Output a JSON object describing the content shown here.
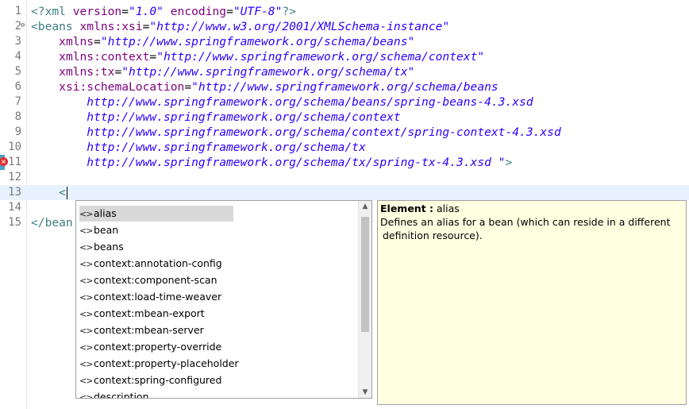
{
  "editor": {
    "lines": [
      {
        "n": "1",
        "parts": [
          {
            "c": "pi",
            "t": "<?xml "
          },
          {
            "c": "attr",
            "t": "version"
          },
          {
            "c": "",
            "t": "="
          },
          {
            "c": "val",
            "t": "\"1.0\""
          },
          {
            "c": "",
            "t": " "
          },
          {
            "c": "attr",
            "t": "encoding"
          },
          {
            "c": "",
            "t": "="
          },
          {
            "c": "val",
            "t": "\"UTF-8\""
          },
          {
            "c": "pi",
            "t": "?>"
          }
        ]
      },
      {
        "n": "2",
        "parts": [
          {
            "c": "tag",
            "t": "<beans "
          },
          {
            "c": "attr",
            "t": "xmlns:xsi"
          },
          {
            "c": "",
            "t": "="
          },
          {
            "c": "val",
            "t": "\"http://www.w3.org/2001/XMLSchema-instance\""
          }
        ]
      },
      {
        "n": "3",
        "parts": [
          {
            "c": "",
            "t": "    "
          },
          {
            "c": "attr",
            "t": "xmlns"
          },
          {
            "c": "",
            "t": "="
          },
          {
            "c": "val",
            "t": "\"http://www.springframework.org/schema/beans\""
          }
        ]
      },
      {
        "n": "4",
        "parts": [
          {
            "c": "",
            "t": "    "
          },
          {
            "c": "attr",
            "t": "xmlns:context"
          },
          {
            "c": "",
            "t": "="
          },
          {
            "c": "val",
            "t": "\"http://www.springframework.org/schema/context\""
          }
        ]
      },
      {
        "n": "5",
        "parts": [
          {
            "c": "",
            "t": "    "
          },
          {
            "c": "attr",
            "t": "xmlns:tx"
          },
          {
            "c": "",
            "t": "="
          },
          {
            "c": "val",
            "t": "\"http://www.springframework.org/schema/tx\""
          }
        ]
      },
      {
        "n": "6",
        "parts": [
          {
            "c": "",
            "t": "    "
          },
          {
            "c": "attr",
            "t": "xsi:schemaLocation"
          },
          {
            "c": "",
            "t": "="
          },
          {
            "c": "val",
            "t": "\"http://www.springframework.org/schema/beans"
          }
        ]
      },
      {
        "n": "7",
        "parts": [
          {
            "c": "",
            "t": "        "
          },
          {
            "c": "val",
            "t": "http://www.springframework.org/schema/beans/spring-beans-4.3.xsd"
          }
        ]
      },
      {
        "n": "8",
        "parts": [
          {
            "c": "",
            "t": "        "
          },
          {
            "c": "val",
            "t": "http://www.springframework.org/schema/context"
          }
        ]
      },
      {
        "n": "9",
        "parts": [
          {
            "c": "",
            "t": "        "
          },
          {
            "c": "val",
            "t": "http://www.springframework.org/schema/context/spring-context-4.3.xsd"
          }
        ]
      },
      {
        "n": "10",
        "parts": [
          {
            "c": "",
            "t": "        "
          },
          {
            "c": "val",
            "t": "http://www.springframework.org/schema/tx"
          }
        ]
      },
      {
        "n": "11",
        "parts": [
          {
            "c": "",
            "t": "        "
          },
          {
            "c": "val",
            "t": "http://www.springframework.org/schema/tx/spring-tx-4.3.xsd \""
          },
          {
            "c": "tag",
            "t": ">"
          }
        ]
      },
      {
        "n": "12",
        "parts": []
      },
      {
        "n": "13",
        "parts": [
          {
            "c": "",
            "t": "    "
          },
          {
            "c": "tag",
            "t": "<"
          }
        ]
      },
      {
        "n": "14",
        "parts": []
      },
      {
        "n": "15",
        "parts": [
          {
            "c": "tag",
            "t": "</bean"
          }
        ]
      }
    ],
    "current_line": "13",
    "error_line": "11",
    "fold_line": "2"
  },
  "completion": {
    "icon_glyph": "<>",
    "selected_index": 0,
    "items": [
      "alias",
      "bean",
      "beans",
      "context:annotation-config",
      "context:component-scan",
      "context:load-time-weaver",
      "context:mbean-export",
      "context:mbean-server",
      "context:property-override",
      "context:property-placeholder",
      "context:spring-configured",
      "description"
    ]
  },
  "doc": {
    "title_label": "Element :",
    "title_value": " alias",
    "desc_line1": "Defines an alias for a bean (which can reside in a different",
    "desc_line2": "definition resource)."
  },
  "colors": {
    "tag": "#3f7f7f",
    "attribute": "#7f007f",
    "value": "#2a00ff",
    "current_line": "#e8f2fe",
    "doc_background": "#ffffe1"
  }
}
